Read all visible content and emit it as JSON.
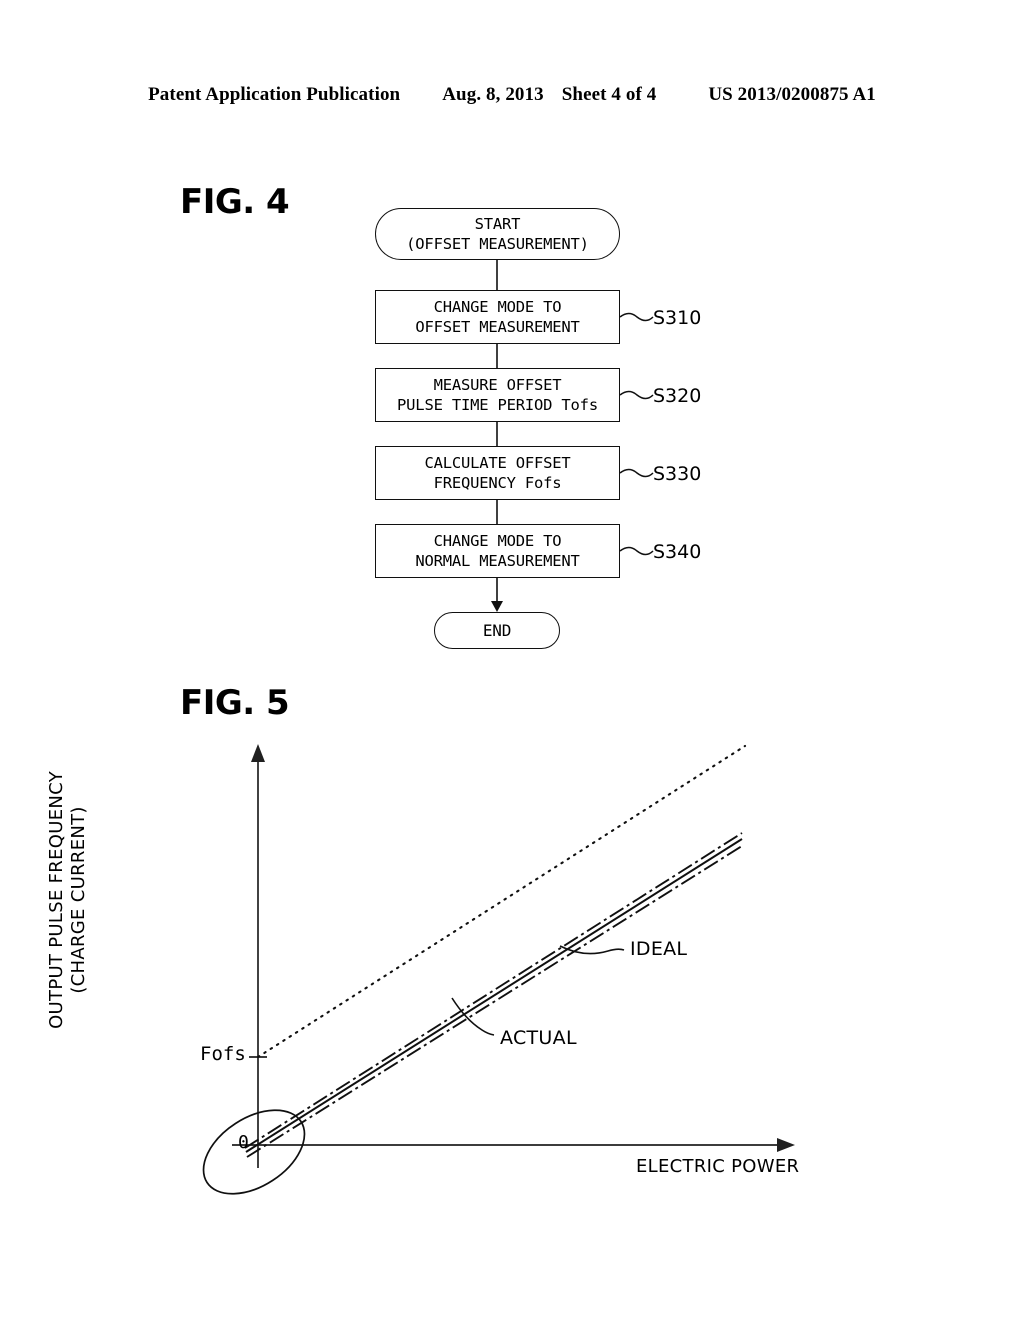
{
  "header": {
    "publication": "Patent Application Publication",
    "date": "Aug. 8, 2013",
    "sheet": "Sheet 4 of 4",
    "number": "US 2013/0200875 A1"
  },
  "figures": {
    "fig4": {
      "label": "FIG. 4",
      "nodes": [
        {
          "id": "start",
          "shape": "terminal",
          "line1": "START",
          "line2": "(OFFSET MEASUREMENT)",
          "tag": ""
        },
        {
          "id": "s310",
          "shape": "process",
          "line1": "CHANGE MODE TO",
          "line2": "OFFSET MEASUREMENT",
          "tag": "S310"
        },
        {
          "id": "s320",
          "shape": "process",
          "line1": "MEASURE OFFSET",
          "line2": "PULSE TIME PERIOD Tofs",
          "tag": "S320"
        },
        {
          "id": "s330",
          "shape": "process",
          "line1": "CALCULATE OFFSET",
          "line2": "FREQUENCY Fofs",
          "tag": "S330"
        },
        {
          "id": "s340",
          "shape": "process",
          "line1": "CHANGE MODE TO",
          "line2": "NORMAL MEASUREMENT",
          "tag": "S340"
        },
        {
          "id": "end",
          "shape": "terminal",
          "line1": "END",
          "line2": "",
          "tag": ""
        }
      ]
    },
    "fig5": {
      "label": "FIG. 5"
    }
  },
  "chart_data": {
    "type": "line",
    "title": "FIG. 5",
    "xlabel": "ELECTRIC POWER",
    "ylabel_line1": "OUTPUT PULSE FREQUENCY",
    "ylabel_line2": "(CHARGE CURRENT)",
    "origin_label": "0",
    "y_tick_labels": [
      "Fofs"
    ],
    "y_ticks": [
      {
        "label": "Fofs",
        "value": 0.225
      }
    ],
    "grid": false,
    "axis_arrows": true,
    "xlim": [
      0,
      1
    ],
    "ylim": [
      0,
      1
    ],
    "legend_position": "inline-annotations",
    "annotations": [
      {
        "text": "IDEAL",
        "points_to": "ideal-offset-solid-line"
      },
      {
        "text": "ACTUAL",
        "points_to": "actual-solid-line"
      }
    ],
    "series": [
      {
        "name": "IDEAL (offset reference)",
        "style": "dotted",
        "x": [
          0,
          1.0
        ],
        "y": [
          0.225,
          1.0
        ],
        "note": "dotted line starting at Fofs on the y-axis"
      },
      {
        "name": "IDEAL (measured, upper)",
        "style": "dash-dot",
        "x": [
          0,
          0.93
        ],
        "y": [
          0.012,
          0.7
        ],
        "note": "upper line of the bundle from the origin region"
      },
      {
        "name": "ACTUAL (middle)",
        "style": "solid",
        "x": [
          0,
          0.93
        ],
        "y": [
          0.0,
          0.682
        ],
        "note": "middle solid line of the bundle"
      },
      {
        "name": "ACTUAL (lower)",
        "style": "dash-dot",
        "x": [
          0,
          0.93
        ],
        "y": [
          -0.012,
          0.662
        ],
        "note": "lower line of the bundle"
      }
    ],
    "callout_ellipse": {
      "label": "origin detail ellipse",
      "center_x": 0.03,
      "center_y": 0.01,
      "rotation_deg": -35
    }
  }
}
